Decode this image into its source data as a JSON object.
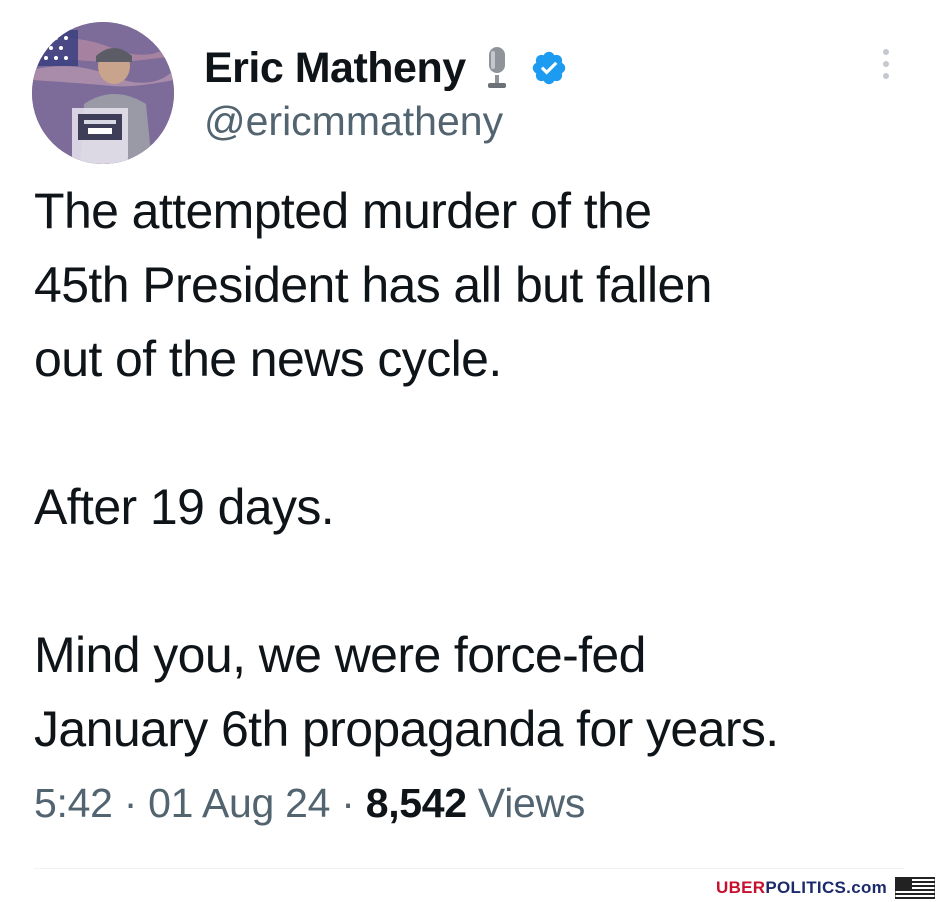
{
  "tweet": {
    "display_name": "Eric Matheny",
    "handle": "@ericmmatheny",
    "text_lines": [
      "The attempted murder of the",
      "45th President has all but fallen",
      "out of the news cycle.",
      "",
      "After 19 days.",
      "",
      "Mind you, we were force-fed",
      "January 6th propaganda for years."
    ],
    "time": "5:42",
    "separator": "·",
    "date": "01 Aug 24",
    "views_count": "8,542",
    "views_label": "Views"
  },
  "icons": {
    "avatar": "profile-photo",
    "badge": "microphone-icon",
    "verified": "verified-badge-icon",
    "menu": "more-options-icon",
    "flag": "us-flag-icon"
  },
  "watermark": {
    "part_red": "UBER",
    "part_blue": "POLITICS.com"
  },
  "colors": {
    "primary_text": "#0f1419",
    "secondary_text": "#536471",
    "verified_blue": "#1d9bf0",
    "watermark_red": "#c8102e",
    "watermark_blue": "#1b2a6b"
  }
}
